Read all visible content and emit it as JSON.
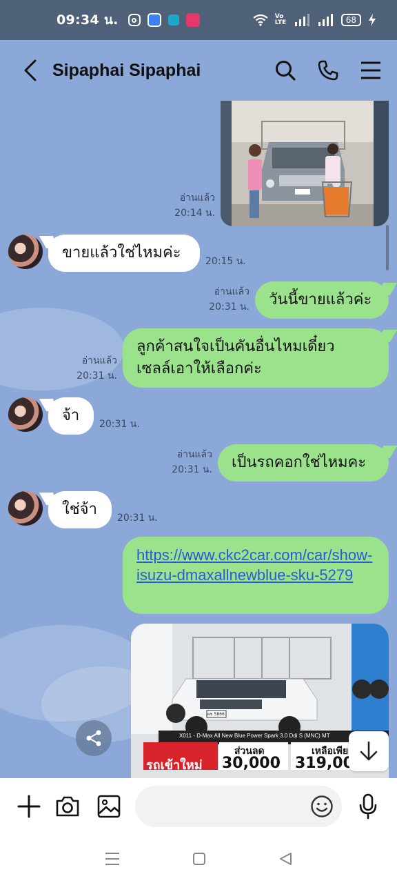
{
  "status_bar": {
    "time": "09:34 น.",
    "volte_label": "Vo LTE",
    "battery": "68"
  },
  "header": {
    "contact_name": "Sipaphai Sipaphai"
  },
  "messages": {
    "m1_read": "อ่านแล้ว",
    "m1_time": "20:14 น.",
    "m2_text": "ขายแล้วใช่ไหมค่ะ",
    "m2_time": "20:15 น.",
    "m3_read": "อ่านแล้ว",
    "m3_time": "20:31 น.",
    "m3_text": "วันนี้ขายแล้วค่ะ",
    "m4_read": "อ่านแล้ว",
    "m4_time": "20:31 น.",
    "m4_line1": "ลูกค้าสนใจเป็นคันอื่นไหมเดี๋ยว",
    "m4_line2": "เซลล์เอาให้เลือกค่ะ",
    "m5_text": "จ้า",
    "m5_time": "20:31 น.",
    "m6_read": "อ่านแล้ว",
    "m6_time": "20:31 น.",
    "m6_text": "เป็นรถคอกใช่ไหมคะ",
    "m7_text": "ใช่จ้า",
    "m7_time": "20:31 น.",
    "m8_link": "https://www.ckc2car.com/car/show-isuzu-dmaxallnewblue-sku-5279"
  },
  "card": {
    "caption": "X011 - D-Max All New Blue Power Spark 3.0 Ddi S (MNC) MT",
    "plate": "ผข 5866",
    "promo_left": "รถเข้าใหม่",
    "discount_label": "ส่วนลด",
    "discount_value": "30,000",
    "remain_label": "เหลือเพียง",
    "remain_value": "319,00"
  },
  "colors": {
    "chat_bg": "#8ba8d8",
    "outgoing_bubble": "#9be28c",
    "incoming_bubble": "#ffffff",
    "status_bar": "#4f6178",
    "link": "#2a5bd7"
  },
  "icons": {
    "back": "chevron-left",
    "search": "search",
    "call": "phone",
    "menu": "hamburger",
    "add": "plus",
    "camera": "camera",
    "gallery": "image",
    "emoji": "smiley",
    "mic": "microphone",
    "share": "share",
    "scroll_down": "arrow-down"
  }
}
